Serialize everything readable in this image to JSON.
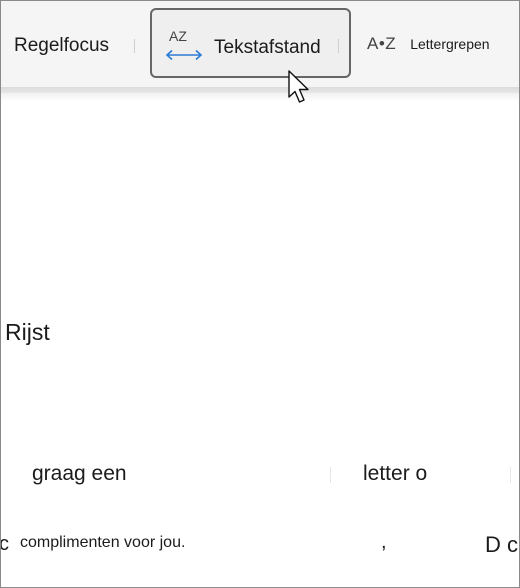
{
  "toolbar": {
    "regelfocus_label": "Regelfocus",
    "tekstafstand_label": "Tekstafstand",
    "tekstafstand_icon_text": "AZ",
    "lettergrepen_label": "Lettergrepen",
    "lettergrepen_icon_text": "A•Z"
  },
  "content": {
    "word": "Rijst",
    "line1_left": "graag een",
    "line1_right": "letter o",
    "line2_fragment_left": "c",
    "line2_text": "complimenten voor jou.",
    "line2_comma": ",",
    "line2_fragment_right": "D c"
  },
  "colors": {
    "toolbar_bg": "#f5f5f5",
    "selected_border": "#666666",
    "icon_arrow": "#2b7cd3",
    "text": "#1b1b1b"
  }
}
